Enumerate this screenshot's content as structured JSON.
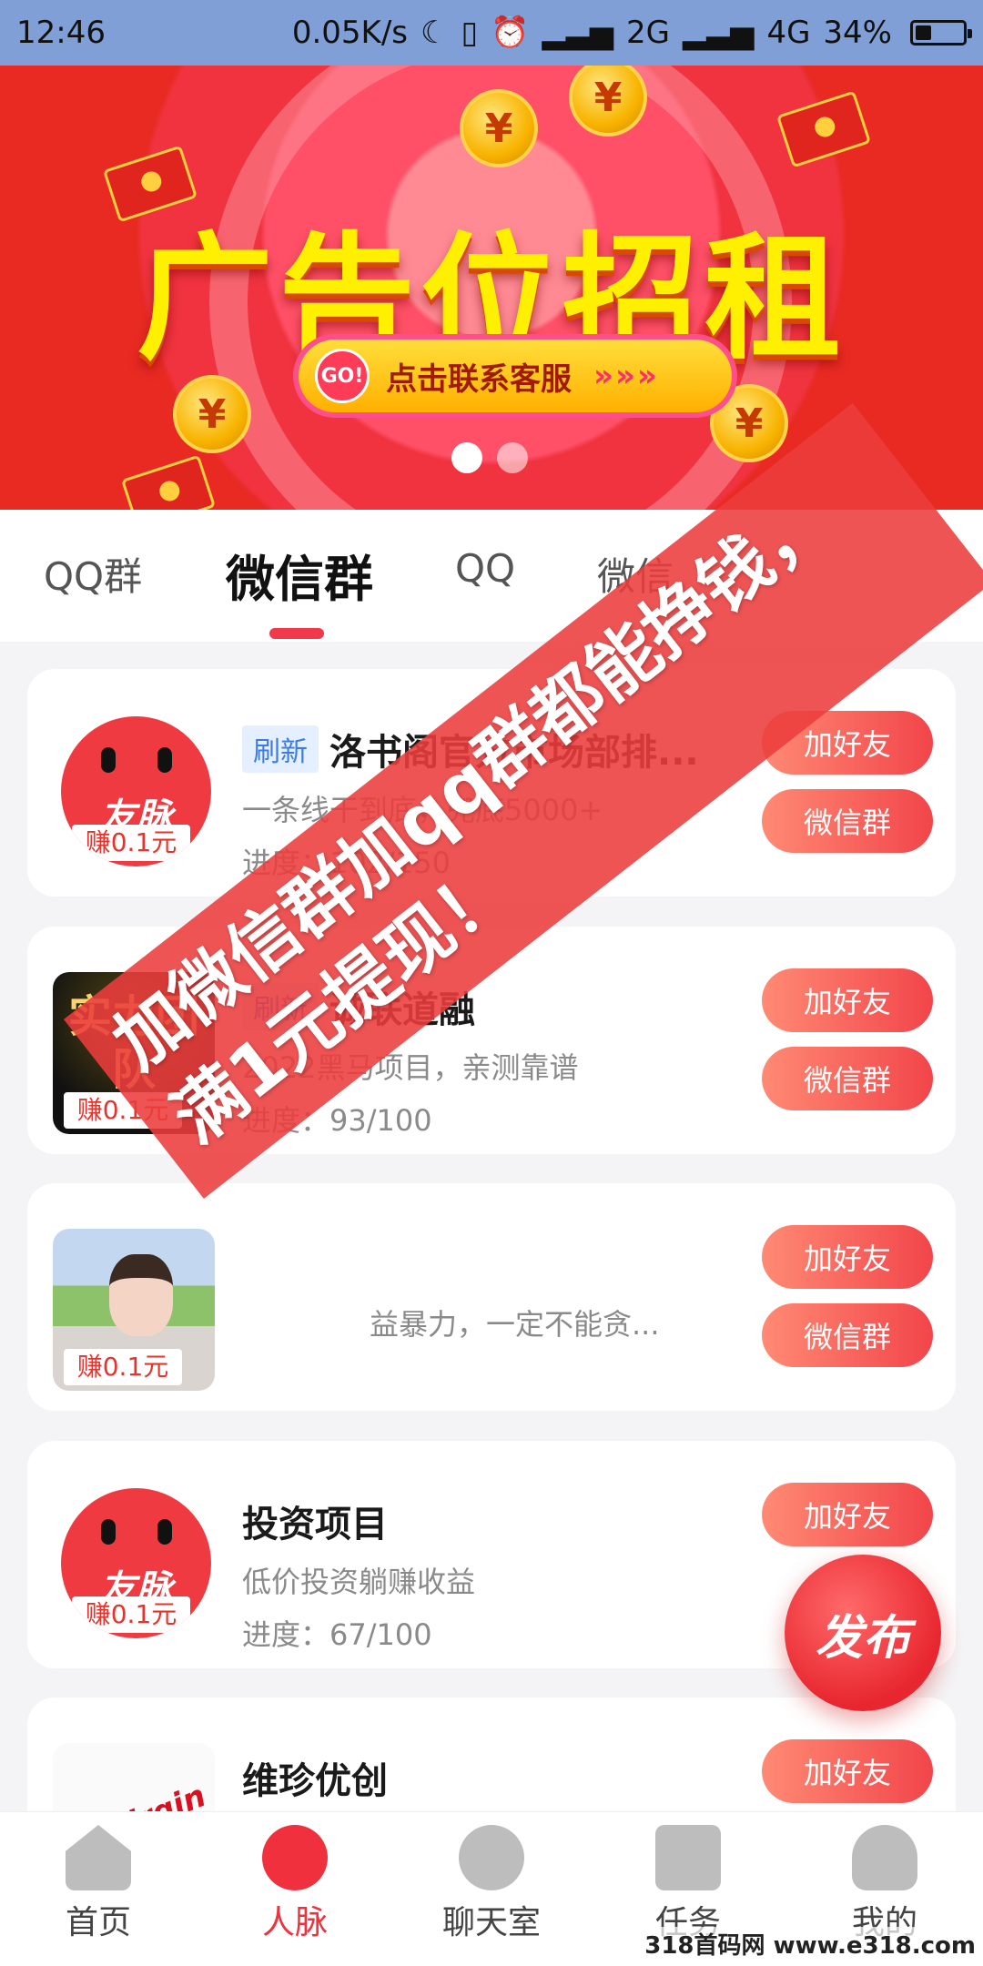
{
  "status_bar": {
    "time": "12:46",
    "net_speed": "0.05K/s",
    "signal_1": "2G",
    "signal_2": "4G",
    "battery_percent": "34%",
    "battery_level": 0.34
  },
  "banner": {
    "headline": "广告位招租",
    "go_label": "GO!",
    "cta_label": "点击联系客服",
    "cta_arrows": "»»»",
    "page_count": 2,
    "active_page": 1
  },
  "tabs": [
    {
      "label": "QQ群",
      "active": false
    },
    {
      "label": "微信群",
      "active": true
    },
    {
      "label": "QQ",
      "active": false
    },
    {
      "label": "微信",
      "active": false
    }
  ],
  "cards": [
    {
      "badge": "刷新",
      "title": "洛书阁官方市场部排...",
      "desc": "一条线干到底，兜底5000+",
      "progress": "进度：102/150",
      "earn": "赚0.1元",
      "avatar_text": "友脉",
      "btn1": "加好友",
      "btn2": "微信群"
    },
    {
      "badge": "刷新",
      "title": "诚联道融",
      "desc": "2022黑马项目，亲测靠谱",
      "progress": "进度：93/100",
      "earn": "赚0.1元",
      "avatar_text": "实力团队",
      "btn1": "加好友",
      "btn2": "微信群"
    },
    {
      "badge": "",
      "title": "",
      "desc": "益暴力，一定不能贪...",
      "progress": "",
      "earn": "赚0.1元",
      "avatar_text": "",
      "btn1": "加好友",
      "btn2": "微信群"
    },
    {
      "badge": "",
      "title": "投资项目",
      "desc": "低价投资躺赚收益",
      "progress": "进度：67/100",
      "earn": "赚0.1元",
      "avatar_text": "友脉",
      "btn1": "加好友",
      "btn2": ""
    },
    {
      "badge": "",
      "title": "维珍优创",
      "desc": "",
      "progress": "",
      "earn": "",
      "avatar_text": "Virgin",
      "btn1": "加好友",
      "btn2": ""
    }
  ],
  "fab_label": "发布",
  "nav": [
    {
      "label": "首页",
      "icon": "home-icon",
      "active": false
    },
    {
      "label": "人脉",
      "icon": "planet-icon",
      "active": true
    },
    {
      "label": "聊天室",
      "icon": "chat-icon",
      "active": false
    },
    {
      "label": "任务",
      "icon": "task-icon",
      "active": false
    },
    {
      "label": "我的",
      "icon": "profile-icon",
      "active": false
    }
  ],
  "overlay": {
    "line1": "加微信群加qq群都能挣钱，",
    "line2": "满1元提现！"
  },
  "watermark": "318首码网 www.e318.com",
  "colors": {
    "accent": "#f0394a",
    "badge_text": "#3c7be0",
    "statusbar": "#7f9fd6"
  }
}
